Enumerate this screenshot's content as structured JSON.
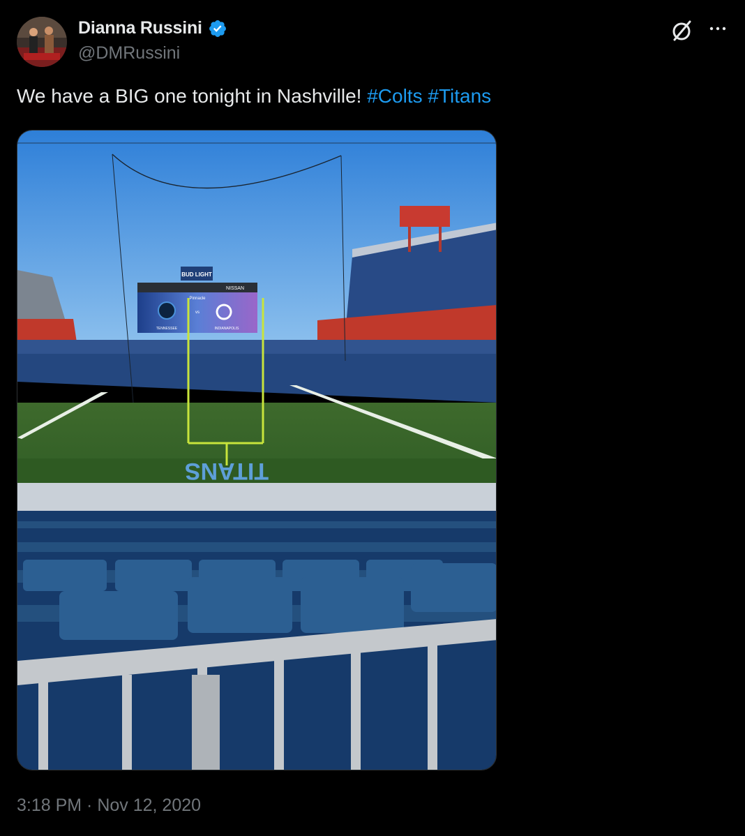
{
  "author": {
    "display_name": "Dianna Russini",
    "handle": "@DMRussini",
    "verified": true,
    "verified_color": "#1d9bf0",
    "avatar_icon": "profile-photo"
  },
  "actions": {
    "grok_icon": "grok-slash-circle-icon",
    "more_icon": "more-horizontal-icon"
  },
  "tweet": {
    "text_main": "We have a BIG one tonight in Nashville!",
    "hashtags": [
      "#Colts",
      "#Titans"
    ],
    "hashtag_color": "#1d9bf0"
  },
  "media": {
    "type": "photo",
    "scoreboard_top": "BUD LIGHT",
    "scoreboard_sponsor": "NISSAN",
    "scoreboard_label": "Pinnacle",
    "scoreboard_left": "TENNESSEE",
    "scoreboard_right": "INDIANAPOLIS",
    "scoreboard_vs": "vs",
    "endzone_text": "TITANS"
  },
  "meta": {
    "timestamp": "3:18 PM · Nov 12, 2020"
  }
}
